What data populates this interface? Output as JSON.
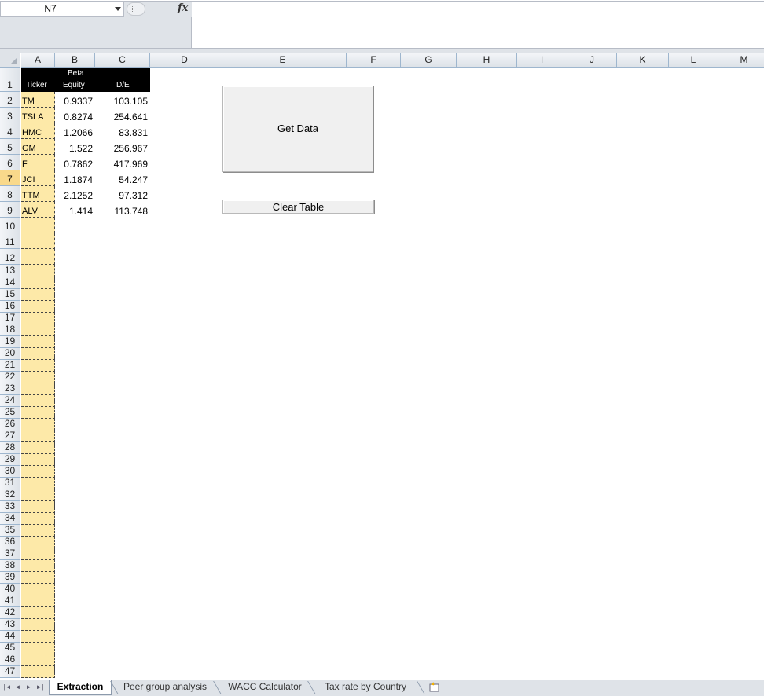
{
  "formula_bar": {
    "name_box": "N7",
    "fx_label": "fx",
    "formula_value": ""
  },
  "columns": [
    "A",
    "B",
    "C",
    "D",
    "E",
    "F",
    "G",
    "H",
    "I",
    "J",
    "K",
    "L",
    "M"
  ],
  "active_cell": {
    "column": "N",
    "row": 7
  },
  "table": {
    "headers": {
      "ticker": "Ticker",
      "beta_line1": "Beta",
      "beta_line2": "Equity",
      "de": "D/E"
    },
    "rows": [
      {
        "ticker": "TM",
        "beta": "0.9337",
        "de": "103.105"
      },
      {
        "ticker": "TSLA",
        "beta": "0.8274",
        "de": "254.641"
      },
      {
        "ticker": "HMC",
        "beta": "1.2066",
        "de": "83.831"
      },
      {
        "ticker": "GM",
        "beta": "1.522",
        "de": "256.967"
      },
      {
        "ticker": "F",
        "beta": "0.7862",
        "de": "417.969"
      },
      {
        "ticker": "JCI",
        "beta": "1.1874",
        "de": "54.247"
      },
      {
        "ticker": "TTM",
        "beta": "2.1252",
        "de": "97.312"
      },
      {
        "ticker": "ALV",
        "beta": "1.414",
        "de": "113.748"
      }
    ]
  },
  "row_numbers": [
    "1",
    "2",
    "3",
    "4",
    "5",
    "6",
    "7",
    "8",
    "9",
    "10",
    "11",
    "12",
    "13",
    "14",
    "15",
    "16",
    "17",
    "18",
    "19",
    "20",
    "21",
    "22",
    "23",
    "24",
    "25",
    "26",
    "27",
    "28",
    "29",
    "30",
    "31",
    "32",
    "33",
    "34",
    "35",
    "36",
    "37",
    "38",
    "39",
    "40",
    "41",
    "42",
    "43",
    "44",
    "45",
    "46",
    "47"
  ],
  "buttons": {
    "get_data": "Get Data",
    "clear_table": "Clear Table"
  },
  "sheets": [
    "Extraction",
    "Peer group analysis",
    "WACC Calculator",
    "Tax rate by Country"
  ],
  "active_sheet": "Extraction",
  "colors": {
    "header_bg": "#dfe3e8",
    "ticker_fill": "#fde9a8",
    "active_header": "#f9d98b",
    "table_header_bg": "#000000"
  }
}
